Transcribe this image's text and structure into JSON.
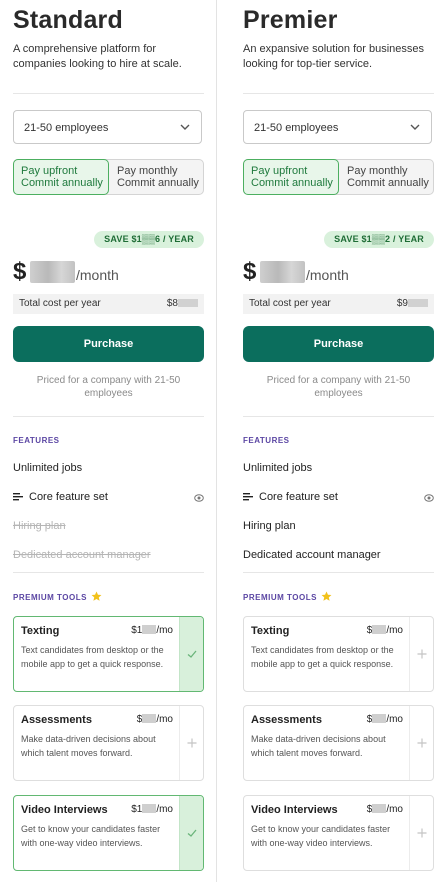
{
  "plans": [
    {
      "name": "Standard",
      "description": "A comprehensive platform for companies looking to hire at scale.",
      "employees_select": "21-50 employees",
      "billing": {
        "selected": "upfront",
        "upfront_label": "Pay upfront",
        "upfront_sub": "Commit annually",
        "monthly_label": "Pay monthly",
        "monthly_sub": "Commit annually"
      },
      "save_badge": "SAVE $1▒▒6 / YEAR",
      "price": {
        "currency": "$",
        "per": "/month"
      },
      "total": {
        "label": "Total cost per year",
        "amount": "$8"
      },
      "purchase_label": "Purchase",
      "priced_note": "Priced for a company with 21-50 employees",
      "features_title": "FEATURES",
      "features": [
        {
          "label": "Unlimited jobs",
          "included": true
        },
        {
          "label": "Core feature set",
          "included": true,
          "icon": "list-icon",
          "info": "eye-icon"
        },
        {
          "label": "Hiring plan",
          "included": false
        },
        {
          "label": "Dedicated account manager",
          "included": false
        }
      ],
      "premium_title": "PREMIUM TOOLS",
      "tools": [
        {
          "name": "Texting",
          "price_prefix": "$1",
          "price_suffix": "/mo",
          "description": "Text candidates from desktop or the mobile app to get a quick response.",
          "selected": true
        },
        {
          "name": "Assessments",
          "price_prefix": "$",
          "price_suffix": "/mo",
          "description": "Make data-driven decisions about which talent moves forward.",
          "selected": false
        },
        {
          "name": "Video Interviews",
          "price_prefix": "$1",
          "price_suffix": "/mo",
          "description": "Get to know your candidates faster with one-way video interviews.",
          "selected": true
        }
      ]
    },
    {
      "name": "Premier",
      "description": "An expansive solution for businesses looking for top-tier service.",
      "employees_select": "21-50 employees",
      "billing": {
        "selected": "upfront",
        "upfront_label": "Pay upfront",
        "upfront_sub": "Commit annually",
        "monthly_label": "Pay monthly",
        "monthly_sub": "Commit annually"
      },
      "save_badge": "SAVE $1▒▒2 / YEAR",
      "price": {
        "currency": "$",
        "per": "/month"
      },
      "total": {
        "label": "Total cost per year",
        "amount": "$9"
      },
      "purchase_label": "Purchase",
      "priced_note": "Priced for a company with 21-50 employees",
      "features_title": "FEATURES",
      "features": [
        {
          "label": "Unlimited jobs",
          "included": true
        },
        {
          "label": "Core feature set",
          "included": true,
          "icon": "list-icon",
          "info": "eye-icon"
        },
        {
          "label": "Hiring plan",
          "included": true
        },
        {
          "label": "Dedicated account manager",
          "included": true
        }
      ],
      "premium_title": "PREMIUM TOOLS",
      "tools": [
        {
          "name": "Texting",
          "price_prefix": "$",
          "price_suffix": "/mo",
          "description": "Text candidates from desktop or the mobile app to get a quick response.",
          "selected": false
        },
        {
          "name": "Assessments",
          "price_prefix": "$",
          "price_suffix": "/mo",
          "description": "Make data-driven decisions about which talent moves forward.",
          "selected": false
        },
        {
          "name": "Video Interviews",
          "price_prefix": "$",
          "price_suffix": "/mo",
          "description": "Get to know your candidates faster with one-way video interviews.",
          "selected": false
        }
      ]
    }
  ],
  "colors": {
    "purchase_bg": "#0b6e5d",
    "selected_border": "#62b872",
    "selected_fill": "#d8f0db",
    "section_title": "#5b46a3",
    "badge_bg": "#d9f1dc",
    "star": "#f2c21b"
  }
}
